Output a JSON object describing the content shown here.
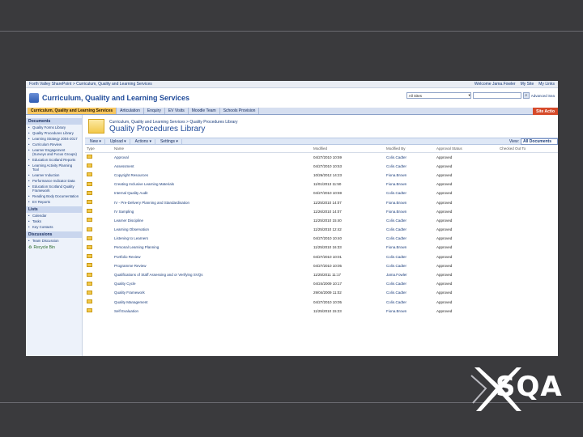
{
  "topbar": {
    "breadcrumb": "Forth Valley SharePoint > Curriculum, Quality and Learning Services",
    "welcome": "Welcome Jama.Fowler",
    "my_site": "My Site",
    "my_links": "My Links"
  },
  "header": {
    "site_title": "Curriculum, Quality and Learning Services",
    "scope_value": "All Sites",
    "advanced_search": "Advanced Sea"
  },
  "tabs": [
    {
      "label": "Curriculum, Quality and Learning Services"
    },
    {
      "label": "Articulation"
    },
    {
      "label": "Enquiry"
    },
    {
      "label": "EV Visits"
    },
    {
      "label": "Moodle Team"
    },
    {
      "label": "Schools Provision"
    }
  ],
  "site_actions": "Site Actio",
  "left_nav": {
    "documents_title": "Documents",
    "documents": [
      "Quality Forms Library",
      "Quality Procedures Library",
      "Learning Strategy 2004-2017",
      "Curriculum Review",
      "Learner Engagement (Surveys and Focus Groups)",
      "Education Scotland Reports",
      "Learning Activity Planning Tool",
      "Learner Induction",
      "Performance Indicator Data",
      "Education Scotland Quality Framework",
      "Reading Body Documentation",
      "EV Reports"
    ],
    "lists_title": "Lists",
    "lists": [
      "Calendar",
      "Tasks",
      "Key Contacts"
    ],
    "discussions_title": "Discussions",
    "discussions": [
      "Team Discussion"
    ],
    "recycle_bin": "Recycle Bin"
  },
  "main": {
    "breadcrumb": "Curriculum, Quality and Learning Services > Quality Procedures Library",
    "page_title": "Quality Procedures Library",
    "toolbar": {
      "new": "New ▾",
      "upload": "Upload ▾",
      "actions": "Actions ▾",
      "settings": "Settings ▾"
    },
    "view_label": "View:",
    "view_value": "All Documents",
    "columns": [
      "Type",
      "Name",
      "Modified",
      "Modified By",
      "Approval Status",
      "Checked Out To"
    ],
    "rows": [
      {
        "name": "Approval",
        "modified": "04/27/2010 10:59",
        "by": "Colin.Cadter",
        "status": "Approved"
      },
      {
        "name": "Assessment",
        "modified": "04/27/2010 10:53",
        "by": "Colin.Cadter",
        "status": "Approved"
      },
      {
        "name": "Copyright Resources",
        "modified": "10/26/2012 14:23",
        "by": "Fiona.Brown",
        "status": "Approved"
      },
      {
        "name": "Creating Inclusive Learning Materials",
        "modified": "11/01/2013 11:50",
        "by": "Fiona.Brown",
        "status": "Approved"
      },
      {
        "name": "Internal Quality Audit",
        "modified": "04/27/2010 10:59",
        "by": "Colin.Cadter",
        "status": "Approved"
      },
      {
        "name": "IV - Pre-Delivery Planning and Standardisation",
        "modified": "11/25/2010 14:07",
        "by": "Fiona.Brown",
        "status": "Approved"
      },
      {
        "name": "IV Sampling",
        "modified": "11/26/2010 14:07",
        "by": "Fiona.Brown",
        "status": "Approved"
      },
      {
        "name": "Learner Discipline",
        "modified": "11/25/2010 15:40",
        "by": "Colin.Cadter",
        "status": "Approved"
      },
      {
        "name": "Learning Observation",
        "modified": "11/25/2010 12:42",
        "by": "Colin.Cadter",
        "status": "Approved"
      },
      {
        "name": "Listening to Learners",
        "modified": "04/27/2010 10:40",
        "by": "Colin.Cadter",
        "status": "Approved"
      },
      {
        "name": "Personal Learning Planning",
        "modified": "11/25/2010 16:33",
        "by": "Fiona.Brown",
        "status": "Approved"
      },
      {
        "name": "Portfolio Review",
        "modified": "04/27/2010 10:01",
        "by": "Colin.Cadter",
        "status": "Approved"
      },
      {
        "name": "Programme Review",
        "modified": "04/27/2010 10:05",
        "by": "Colin.Cadter",
        "status": "Approved"
      },
      {
        "name": "Qualifications of Staff Assessing and or Verifying SVQs",
        "modified": "11/25/2011 11:17",
        "by": "Jama.Fowler",
        "status": "Approved"
      },
      {
        "name": "Quality Cycle",
        "modified": "04/24/2009 10:17",
        "by": "Colin.Cadter",
        "status": "Approved"
      },
      {
        "name": "Quality Framework",
        "modified": "29/04/2009 11:02",
        "by": "Colin.Cadter",
        "status": "Approved"
      },
      {
        "name": "Quality Management",
        "modified": "04/27/2010 10:05",
        "by": "Colin.Cadter",
        "status": "Approved"
      },
      {
        "name": "Self Evaluation",
        "modified": "11/25/2010 15:23",
        "by": "Fiona.Brown",
        "status": "Approved"
      }
    ]
  },
  "logo": {
    "text": "SQA"
  }
}
